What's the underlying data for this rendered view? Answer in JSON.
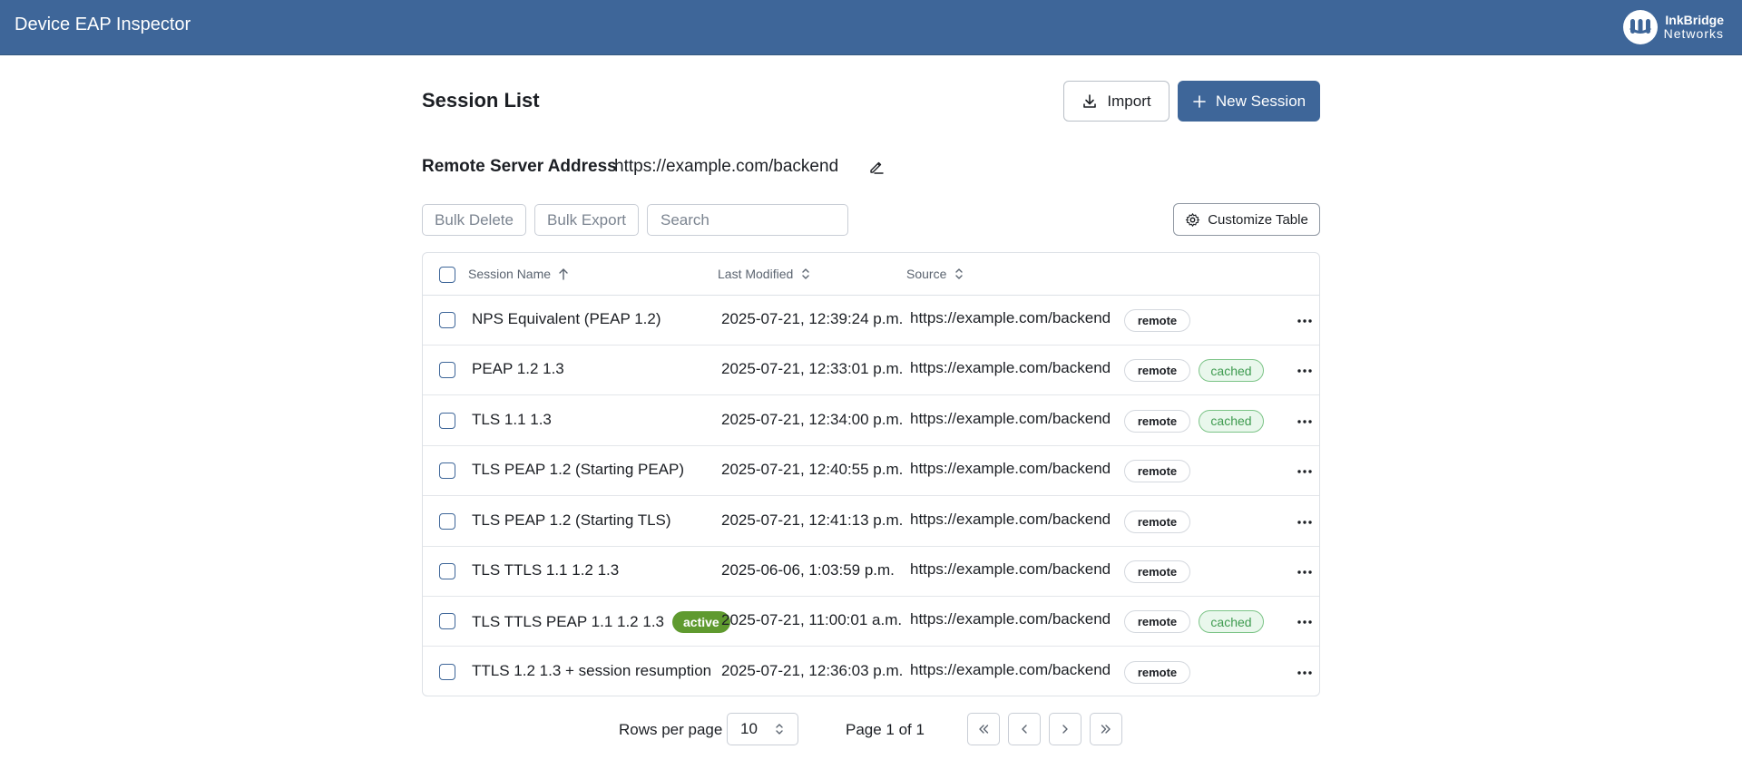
{
  "header": {
    "app_title": "Device EAP Inspector",
    "brand_line1": "InkBridge",
    "brand_line2": "Networks"
  },
  "page": {
    "title": "Session List",
    "import_label": "Import",
    "new_session_label": "New Session"
  },
  "server": {
    "label": "Remote Server Address",
    "value": "https://example.com/backend"
  },
  "toolbar": {
    "bulk_delete": "Bulk Delete",
    "bulk_export": "Bulk Export",
    "search_placeholder": "Search",
    "customize": "Customize Table"
  },
  "table": {
    "columns": [
      "Session Name",
      "Last Modified",
      "Source"
    ],
    "rows": [
      {
        "name": "NPS Equivalent (PEAP 1.2)",
        "active": "",
        "modified": "2025-07-21, 12:39:24 p.m.",
        "source": "https://example.com/backend",
        "remote": "remote",
        "cached": ""
      },
      {
        "name": "PEAP 1.2 1.3",
        "active": "",
        "modified": "2025-07-21, 12:33:01 p.m.",
        "source": "https://example.com/backend",
        "remote": "remote",
        "cached": "cached"
      },
      {
        "name": "TLS 1.1 1.3",
        "active": "",
        "modified": "2025-07-21, 12:34:00 p.m.",
        "source": "https://example.com/backend",
        "remote": "remote",
        "cached": "cached"
      },
      {
        "name": "TLS PEAP 1.2 (Starting PEAP)",
        "active": "",
        "modified": "2025-07-21, 12:40:55 p.m.",
        "source": "https://example.com/backend",
        "remote": "remote",
        "cached": ""
      },
      {
        "name": "TLS PEAP 1.2 (Starting TLS)",
        "active": "",
        "modified": "2025-07-21, 12:41:13 p.m.",
        "source": "https://example.com/backend",
        "remote": "remote",
        "cached": ""
      },
      {
        "name": "TLS TTLS 1.1 1.2 1.3",
        "active": "",
        "modified": "2025-06-06, 1:03:59 p.m.",
        "source": "https://example.com/backend",
        "remote": "remote",
        "cached": ""
      },
      {
        "name": "TLS TTLS PEAP 1.1 1.2 1.3",
        "active": "active",
        "modified": "2025-07-21, 11:00:01 a.m.",
        "source": "https://example.com/backend",
        "remote": "remote",
        "cached": "cached"
      },
      {
        "name": "TTLS 1.2 1.3 + session resumption",
        "active": "",
        "modified": "2025-07-21, 12:36:03 p.m.",
        "source": "https://example.com/backend",
        "remote": "remote",
        "cached": ""
      }
    ]
  },
  "pagination": {
    "rows_per_page_label": "Rows per page",
    "rows_per_page_value": "10",
    "page_info": "Page 1 of 1"
  },
  "colors": {
    "brand": "#3e6699",
    "active_badge": "#5f9a2f",
    "cached_badge": "#3e9b4f"
  }
}
